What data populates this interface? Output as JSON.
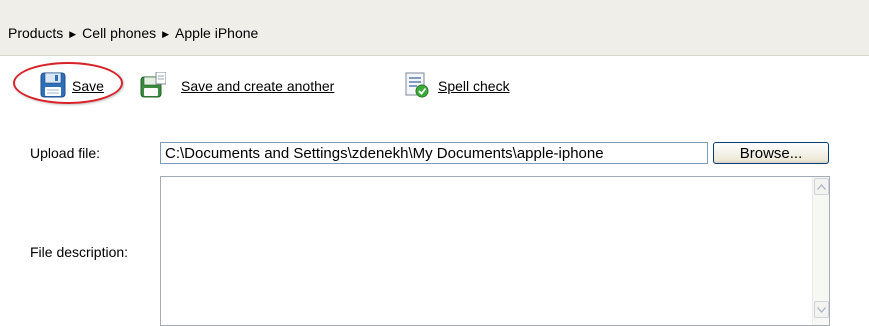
{
  "breadcrumb": {
    "items": [
      "Products",
      "Cell phones",
      "Apple iPhone"
    ],
    "separator_glyph": "▶"
  },
  "toolbar": {
    "save_label": "Save",
    "save_icon": "floppy-disk-icon",
    "save_another_label": "Save and create another",
    "save_another_icon": "save-and-new-icon",
    "spell_check_label": "Spell check",
    "spell_check_icon": "spell-check-icon"
  },
  "form": {
    "upload_label": "Upload file:",
    "upload_value": "C:\\Documents and Settings\\zdenekh\\My Documents\\apple-iphone",
    "browse_label": "Browse...",
    "description_label": "File description:",
    "description_value": ""
  },
  "colors": {
    "highlight_ring": "#d8222a",
    "breadcrumb_bg": "#efeee8"
  }
}
